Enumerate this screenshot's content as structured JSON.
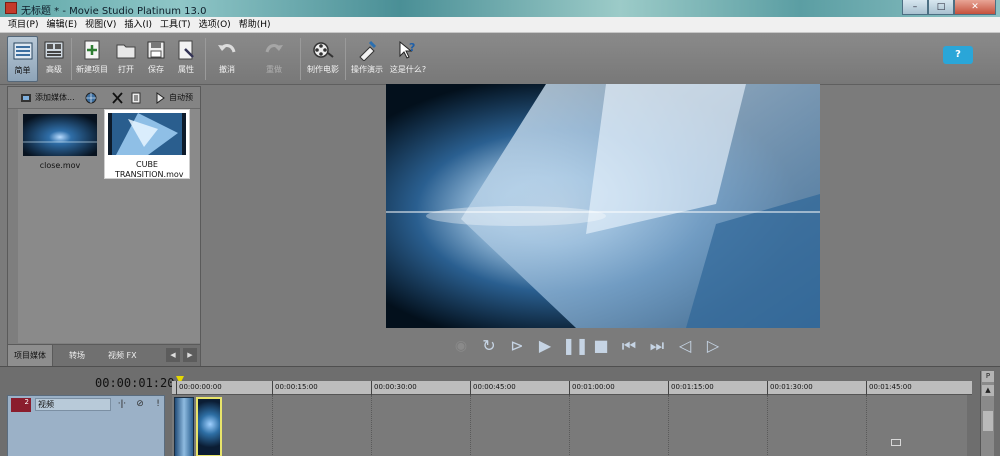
{
  "window": {
    "title": "无标题 * - Movie Studio Platinum 13.0",
    "buttons": {
      "minimize": "–",
      "maximize": "□",
      "close": "✕"
    }
  },
  "menubar": {
    "items": [
      "项目(P)",
      "编辑(E)",
      "视图(V)",
      "插入(I)",
      "工具(T)",
      "选项(O)",
      "帮助(H)"
    ]
  },
  "toolbar": {
    "buttons": [
      {
        "label": "简单",
        "icon": "simple-view-icon",
        "state": "active"
      },
      {
        "label": "高级",
        "icon": "advanced-view-icon"
      },
      {
        "label": "新建项目",
        "icon": "new-project-icon"
      },
      {
        "label": "打开",
        "icon": "open-folder-icon"
      },
      {
        "label": "保存",
        "icon": "save-icon"
      },
      {
        "label": "属性",
        "icon": "properties-icon"
      },
      {
        "label": "撤消",
        "icon": "undo-icon"
      },
      {
        "label": "重做",
        "icon": "redo-icon",
        "state": "disabled"
      },
      {
        "label": "制作电影",
        "icon": "make-movie-icon"
      },
      {
        "label": "操作演示",
        "icon": "show-me-how-icon"
      },
      {
        "label": "这是什么?",
        "icon": "whats-this-icon"
      }
    ],
    "help": "?"
  },
  "media_panel": {
    "toolbar": {
      "add_media": "添加媒体...",
      "auto_preview": "自动预"
    },
    "items": [
      {
        "name": "close.mov"
      },
      {
        "name": "CUBE TRANSITION.mov",
        "selected": true
      }
    ],
    "tabs": [
      "项目媒体",
      "转场",
      "视频 FX"
    ],
    "active_tab": "项目媒体"
  },
  "transport": {
    "icons": [
      "record-icon",
      "loop-icon",
      "play-from-start-icon",
      "play-icon",
      "pause-icon",
      "stop-icon",
      "go-to-start-icon",
      "go-to-end-icon",
      "previous-frame-icon",
      "next-frame-icon"
    ]
  },
  "timeline": {
    "timecode": "00:00:01:20",
    "ruler_labels": [
      "00:00:00:00",
      "00:00:15:00",
      "00:00:30:00",
      "00:00:45:00",
      "00:01:00:00",
      "00:01:15:00",
      "00:01:30:00",
      "00:01:45:00"
    ],
    "track": {
      "number": "2",
      "name": "视频"
    },
    "scroll_labels": {
      "top": "P"
    }
  },
  "colors": {
    "toolbar_bg": "#808080",
    "track_header": "#9bb1c7",
    "help_button": "#2aa6d8",
    "playhead": "#e5d800"
  }
}
